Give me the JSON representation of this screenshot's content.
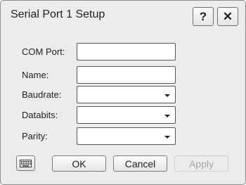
{
  "dialog": {
    "title": "Serial Port 1 Setup",
    "help_label": "?",
    "close_label": "✕"
  },
  "form": {
    "com_port": {
      "label": "COM Port:",
      "value": ""
    },
    "name": {
      "label": "Name:",
      "value": ""
    },
    "baudrate": {
      "label": "Baudrate:",
      "value": ""
    },
    "databits": {
      "label": "Databits:",
      "value": ""
    },
    "parity": {
      "label": "Parity:",
      "value": ""
    }
  },
  "buttons": {
    "ok": "OK",
    "cancel": "Cancel",
    "apply": "Apply"
  },
  "icons": {
    "keyboard": "keyboard-icon",
    "help": "help-icon",
    "close": "close-icon",
    "dropdown": "chevron-down-icon"
  },
  "colors": {
    "dialog_bg": "#ececec",
    "disabled_text": "#a5a5a5"
  }
}
